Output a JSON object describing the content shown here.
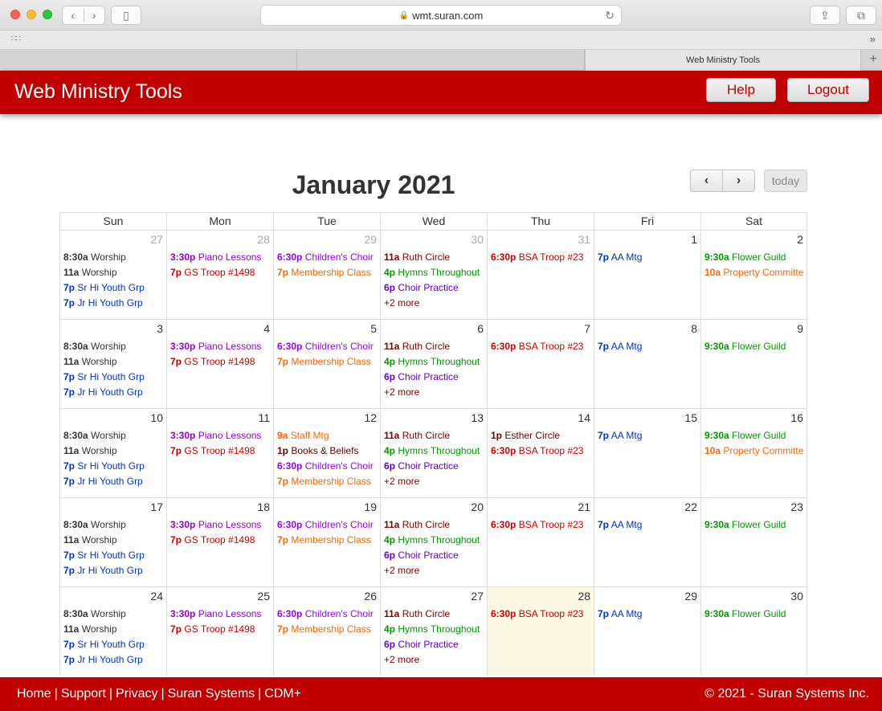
{
  "browser": {
    "url": "wmt.suran.com",
    "tabs": [
      "",
      "",
      "Web Ministry Tools"
    ]
  },
  "app": {
    "title": "Web Ministry Tools",
    "help_label": "Help",
    "logout_label": "Logout",
    "brand_color": "#c00000"
  },
  "calendar": {
    "title": "January 2021",
    "today_label": "today",
    "prev_icon": "‹",
    "next_icon": "›",
    "days_of_week": [
      "Sun",
      "Mon",
      "Tue",
      "Wed",
      "Thu",
      "Fri",
      "Sat"
    ],
    "colors": {
      "worship": "#333333",
      "youth": "#0033cc",
      "piano": "#9900cc",
      "gs": "#cc0000",
      "children": "#9900ff",
      "membership": "#ff6600",
      "ruth": "#800000",
      "hymns": "#009900",
      "choir": "#6600cc",
      "bsa": "#cc0000",
      "aa": "#0033cc",
      "flower": "#009900",
      "property": "#ff6600",
      "staff": "#ff6600",
      "books": "#660000",
      "esther": "#660000"
    },
    "weeks": [
      [
        {
          "num": "27",
          "other": true,
          "events": [
            {
              "t": "8:30a",
              "n": "Worship",
              "c": "worship"
            },
            {
              "t": "11a",
              "n": "Worship",
              "c": "worship"
            },
            {
              "t": "7p",
              "n": "Sr Hi Youth Grp",
              "c": "youth"
            },
            {
              "t": "7p",
              "n": "Jr Hi Youth Grp",
              "c": "youth"
            }
          ]
        },
        {
          "num": "28",
          "other": true,
          "events": [
            {
              "t": "3:30p",
              "n": "Piano Lessons",
              "c": "piano"
            },
            {
              "t": "7p",
              "n": "GS Troop #1498",
              "c": "gs"
            }
          ]
        },
        {
          "num": "29",
          "other": true,
          "events": [
            {
              "t": "6:30p",
              "n": "Children's Choir",
              "c": "children"
            },
            {
              "t": "7p",
              "n": "Membership Class",
              "c": "membership"
            }
          ]
        },
        {
          "num": "30",
          "other": true,
          "events": [
            {
              "t": "11a",
              "n": "Ruth Circle",
              "c": "ruth"
            },
            {
              "t": "4p",
              "n": "Hymns Throughout",
              "c": "hymns"
            },
            {
              "t": "6p",
              "n": "Choir Practice",
              "c": "choir"
            }
          ],
          "more": "+2 more"
        },
        {
          "num": "31",
          "other": true,
          "events": [
            {
              "t": "6:30p",
              "n": "BSA Troop #23",
              "c": "bsa"
            }
          ]
        },
        {
          "num": "1",
          "events": [
            {
              "t": "7p",
              "n": "AA Mtg",
              "c": "aa"
            }
          ]
        },
        {
          "num": "2",
          "events": [
            {
              "t": "9:30a",
              "n": "Flower Guild",
              "c": "flower"
            },
            {
              "t": "10a",
              "n": "Property Committe",
              "c": "property"
            }
          ]
        }
      ],
      [
        {
          "num": "3",
          "events": [
            {
              "t": "8:30a",
              "n": "Worship",
              "c": "worship"
            },
            {
              "t": "11a",
              "n": "Worship",
              "c": "worship"
            },
            {
              "t": "7p",
              "n": "Sr Hi Youth Grp",
              "c": "youth"
            },
            {
              "t": "7p",
              "n": "Jr Hi Youth Grp",
              "c": "youth"
            }
          ]
        },
        {
          "num": "4",
          "events": [
            {
              "t": "3:30p",
              "n": "Piano Lessons",
              "c": "piano"
            },
            {
              "t": "7p",
              "n": "GS Troop #1498",
              "c": "gs"
            }
          ]
        },
        {
          "num": "5",
          "events": [
            {
              "t": "6:30p",
              "n": "Children's Choir",
              "c": "children"
            },
            {
              "t": "7p",
              "n": "Membership Class",
              "c": "membership"
            }
          ]
        },
        {
          "num": "6",
          "events": [
            {
              "t": "11a",
              "n": "Ruth Circle",
              "c": "ruth"
            },
            {
              "t": "4p",
              "n": "Hymns Throughout",
              "c": "hymns"
            },
            {
              "t": "6p",
              "n": "Choir Practice",
              "c": "choir"
            }
          ],
          "more": "+2 more"
        },
        {
          "num": "7",
          "events": [
            {
              "t": "6:30p",
              "n": "BSA Troop #23",
              "c": "bsa"
            }
          ]
        },
        {
          "num": "8",
          "events": [
            {
              "t": "7p",
              "n": "AA Mtg",
              "c": "aa"
            }
          ]
        },
        {
          "num": "9",
          "events": [
            {
              "t": "9:30a",
              "n": "Flower Guild",
              "c": "flower"
            }
          ]
        }
      ],
      [
        {
          "num": "10",
          "events": [
            {
              "t": "8:30a",
              "n": "Worship",
              "c": "worship"
            },
            {
              "t": "11a",
              "n": "Worship",
              "c": "worship"
            },
            {
              "t": "7p",
              "n": "Sr Hi Youth Grp",
              "c": "youth"
            },
            {
              "t": "7p",
              "n": "Jr Hi Youth Grp",
              "c": "youth"
            }
          ]
        },
        {
          "num": "11",
          "events": [
            {
              "t": "3:30p",
              "n": "Piano Lessons",
              "c": "piano"
            },
            {
              "t": "7p",
              "n": "GS Troop #1498",
              "c": "gs"
            }
          ]
        },
        {
          "num": "12",
          "events": [
            {
              "t": "9a",
              "n": "Staff Mtg",
              "c": "staff"
            },
            {
              "t": "1p",
              "n": "Books & Beliefs",
              "c": "books"
            },
            {
              "t": "6:30p",
              "n": "Children's Choir",
              "c": "children"
            },
            {
              "t": "7p",
              "n": "Membership Class",
              "c": "membership"
            }
          ]
        },
        {
          "num": "13",
          "events": [
            {
              "t": "11a",
              "n": "Ruth Circle",
              "c": "ruth"
            },
            {
              "t": "4p",
              "n": "Hymns Throughout",
              "c": "hymns"
            },
            {
              "t": "6p",
              "n": "Choir Practice",
              "c": "choir"
            }
          ],
          "more": "+2 more"
        },
        {
          "num": "14",
          "events": [
            {
              "t": "1p",
              "n": "Esther Circle",
              "c": "esther"
            },
            {
              "t": "6:30p",
              "n": "BSA Troop #23",
              "c": "bsa"
            }
          ]
        },
        {
          "num": "15",
          "events": [
            {
              "t": "7p",
              "n": "AA Mtg",
              "c": "aa"
            }
          ]
        },
        {
          "num": "16",
          "events": [
            {
              "t": "9:30a",
              "n": "Flower Guild",
              "c": "flower"
            },
            {
              "t": "10a",
              "n": "Property Committe",
              "c": "property"
            }
          ]
        }
      ],
      [
        {
          "num": "17",
          "events": [
            {
              "t": "8:30a",
              "n": "Worship",
              "c": "worship"
            },
            {
              "t": "11a",
              "n": "Worship",
              "c": "worship"
            },
            {
              "t": "7p",
              "n": "Sr Hi Youth Grp",
              "c": "youth"
            },
            {
              "t": "7p",
              "n": "Jr Hi Youth Grp",
              "c": "youth"
            }
          ]
        },
        {
          "num": "18",
          "events": [
            {
              "t": "3:30p",
              "n": "Piano Lessons",
              "c": "piano"
            },
            {
              "t": "7p",
              "n": "GS Troop #1498",
              "c": "gs"
            }
          ]
        },
        {
          "num": "19",
          "events": [
            {
              "t": "6:30p",
              "n": "Children's Choir",
              "c": "children"
            },
            {
              "t": "7p",
              "n": "Membership Class",
              "c": "membership"
            }
          ]
        },
        {
          "num": "20",
          "events": [
            {
              "t": "11a",
              "n": "Ruth Circle",
              "c": "ruth"
            },
            {
              "t": "4p",
              "n": "Hymns Throughout",
              "c": "hymns"
            },
            {
              "t": "6p",
              "n": "Choir Practice",
              "c": "choir"
            }
          ],
          "more": "+2 more"
        },
        {
          "num": "21",
          "events": [
            {
              "t": "6:30p",
              "n": "BSA Troop #23",
              "c": "bsa"
            }
          ]
        },
        {
          "num": "22",
          "events": [
            {
              "t": "7p",
              "n": "AA Mtg",
              "c": "aa"
            }
          ]
        },
        {
          "num": "23",
          "events": [
            {
              "t": "9:30a",
              "n": "Flower Guild",
              "c": "flower"
            }
          ]
        }
      ],
      [
        {
          "num": "24",
          "events": [
            {
              "t": "8:30a",
              "n": "Worship",
              "c": "worship"
            },
            {
              "t": "11a",
              "n": "Worship",
              "c": "worship"
            },
            {
              "t": "7p",
              "n": "Sr Hi Youth Grp",
              "c": "youth"
            },
            {
              "t": "7p",
              "n": "Jr Hi Youth Grp",
              "c": "youth"
            }
          ]
        },
        {
          "num": "25",
          "events": [
            {
              "t": "3:30p",
              "n": "Piano Lessons",
              "c": "piano"
            },
            {
              "t": "7p",
              "n": "GS Troop #1498",
              "c": "gs"
            }
          ]
        },
        {
          "num": "26",
          "events": [
            {
              "t": "6:30p",
              "n": "Children's Choir",
              "c": "children"
            },
            {
              "t": "7p",
              "n": "Membership Class",
              "c": "membership"
            }
          ]
        },
        {
          "num": "27",
          "events": [
            {
              "t": "11a",
              "n": "Ruth Circle",
              "c": "ruth"
            },
            {
              "t": "4p",
              "n": "Hymns Throughout",
              "c": "hymns"
            },
            {
              "t": "6p",
              "n": "Choir Practice",
              "c": "choir"
            }
          ],
          "more": "+2 more"
        },
        {
          "num": "28",
          "today": true,
          "events": [
            {
              "t": "6:30p",
              "n": "BSA Troop #23",
              "c": "bsa"
            }
          ]
        },
        {
          "num": "29",
          "events": [
            {
              "t": "7p",
              "n": "AA Mtg",
              "c": "aa"
            }
          ]
        },
        {
          "num": "30",
          "events": [
            {
              "t": "9:30a",
              "n": "Flower Guild",
              "c": "flower"
            }
          ]
        }
      ]
    ]
  },
  "footer": {
    "links": [
      "Home",
      "Support",
      "Privacy",
      "Suran Systems",
      "CDM+"
    ],
    "separator": "|",
    "copyright": "© 2021 - Suran Systems Inc."
  }
}
